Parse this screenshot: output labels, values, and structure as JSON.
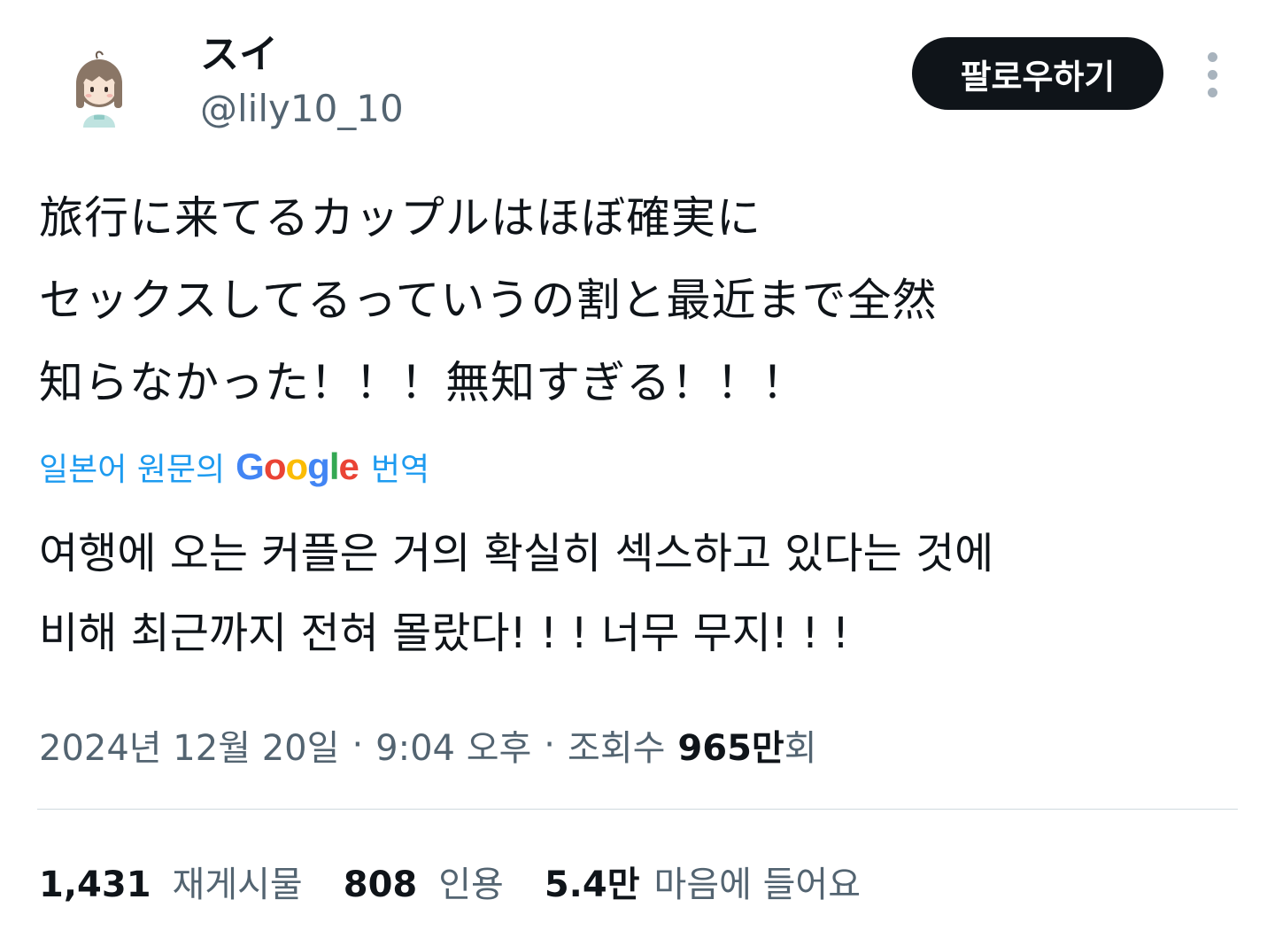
{
  "author": {
    "display_name": "スイ",
    "handle": "@lily10_10"
  },
  "follow_label": "팔로우하기",
  "tweet": {
    "lines": [
      "旅行に来てるカップルはほぼ確実に",
      "セックスしてるっていうの割と最近まで全然",
      "知らなかった！！！無知すぎる！！！"
    ]
  },
  "translation": {
    "prefix": "일본어 원문의",
    "google_letters": [
      "G",
      "o",
      "o",
      "g",
      "l",
      "e"
    ],
    "action": "번역",
    "lines": [
      "여행에 오는 커플은 거의 확실히 섹스하고 있다는 것에",
      "비해 최근까지 전혀 몰랐다! ! ! 너무 무지! ! !"
    ]
  },
  "meta": {
    "date": "2024년 12월 20일",
    "separator": "·",
    "time": "9:04 오후",
    "views_label": "조회수",
    "views_count": "965만",
    "views_suffix": "회"
  },
  "stats": [
    {
      "count": "1,431",
      "label": "재게시물"
    },
    {
      "count": "808",
      "label": "인용"
    },
    {
      "count": "5.4만",
      "label": "마음에 들어요"
    }
  ],
  "colors": {
    "accent": "#1d9bf0",
    "text_primary": "#0f1419",
    "text_secondary": "#536471",
    "button_bg": "#0f1419"
  },
  "icons": {
    "more": "more-vertical-icon",
    "avatar": "avatar-illustration"
  }
}
